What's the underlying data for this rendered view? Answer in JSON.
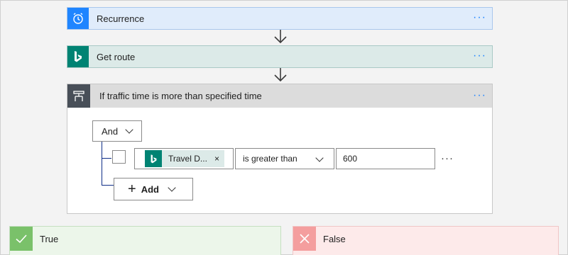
{
  "steps": {
    "recurrence": {
      "title": "Recurrence",
      "more": "···"
    },
    "get_route": {
      "title": "Get route",
      "more": "···"
    },
    "condition": {
      "title": "If traffic time is more than specified time",
      "more": "···"
    }
  },
  "condition": {
    "group_operator": "And",
    "row": {
      "left_token": "Travel D...",
      "left_token_close": "×",
      "operator": "is greater than",
      "value": "600",
      "more": "···"
    },
    "add_label": "Add",
    "add_plus": "+"
  },
  "branches": {
    "true_label": "True",
    "false_label": "False"
  },
  "colors": {
    "recurrence_accent": "#1f85ff",
    "bing_accent": "#008373",
    "condition_accent": "#484f58",
    "true_accent": "#7ac16a",
    "false_accent": "#f49e9e",
    "tree_line": "#0f2e87"
  },
  "icons": {
    "recurrence": "alarm-clock-icon",
    "get_route": "bing-icon",
    "condition": "condition-icon",
    "true": "checkmark-icon",
    "false": "close-x-icon"
  }
}
